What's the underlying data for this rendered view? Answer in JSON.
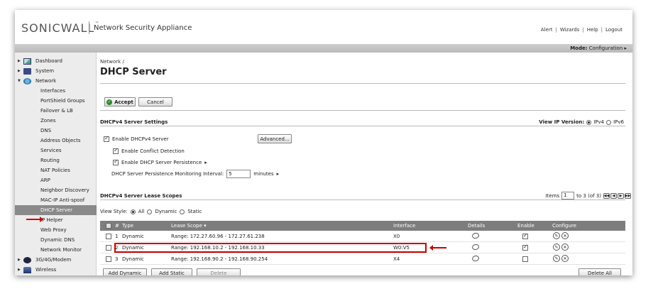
{
  "header": {
    "logo": "SONICWALL",
    "app_title": "Network Security Appliance",
    "links": [
      "Alert",
      "Wizards",
      "Help",
      "Logout"
    ]
  },
  "modebar": {
    "mode_label": "Mode:",
    "mode_value": "Configuration ▸"
  },
  "sidebar": {
    "items": [
      {
        "label": "Dashboard",
        "kind": "top",
        "icon": "dashboard-icon"
      },
      {
        "label": "System",
        "kind": "top",
        "icon": "system-icon"
      },
      {
        "label": "Network",
        "kind": "top",
        "icon": "network-icon",
        "expanded": true
      },
      {
        "label": "Interfaces",
        "kind": "sub"
      },
      {
        "label": "PortShield Groups",
        "kind": "sub"
      },
      {
        "label": "Failover & LB",
        "kind": "sub"
      },
      {
        "label": "Zones",
        "kind": "sub"
      },
      {
        "label": "DNS",
        "kind": "sub"
      },
      {
        "label": "Address Objects",
        "kind": "sub"
      },
      {
        "label": "Services",
        "kind": "sub"
      },
      {
        "label": "Routing",
        "kind": "sub"
      },
      {
        "label": "NAT Policies",
        "kind": "sub"
      },
      {
        "label": "ARP",
        "kind": "sub"
      },
      {
        "label": "Neighbor Discovery",
        "kind": "sub"
      },
      {
        "label": "MAC-IP Anti-spoof",
        "kind": "sub"
      },
      {
        "label": "DHCP Server",
        "kind": "sub",
        "active": true
      },
      {
        "label": "IP Helper",
        "kind": "sub"
      },
      {
        "label": "Web Proxy",
        "kind": "sub"
      },
      {
        "label": "Dynamic DNS",
        "kind": "sub"
      },
      {
        "label": "Network Monitor",
        "kind": "sub"
      },
      {
        "label": "3G/4G/Modem",
        "kind": "top",
        "icon": "modem-icon"
      },
      {
        "label": "Wireless",
        "kind": "top",
        "icon": "wireless-icon"
      }
    ]
  },
  "main": {
    "breadcrumb": "Network /",
    "title": "DHCP Server",
    "accept_label": "Accept",
    "cancel_label": "Cancel",
    "settings": {
      "title": "DHCPv4 Server Settings",
      "ip_version_label": "View IP Version:",
      "ipv4_label": "IPv4",
      "ipv6_label": "IPv6",
      "enable_server_label": "Enable DHCPv4 Server",
      "advanced_label": "Advanced...",
      "conflict_label": "Enable Conflict Detection",
      "persistence_label": "Enable DHCP Server Persistence",
      "interval_label": "DHCP Server Persistence Monitoring Interval:",
      "interval_value": "5",
      "interval_unit": "minutes"
    },
    "scopes": {
      "title": "DHCPv4 Server Lease Scopes",
      "items_label": "Items",
      "items_value": "1",
      "items_suffix": "to 3 (of 3)",
      "view_style_label": "View Style:",
      "view_all": "All",
      "view_dynamic": "Dynamic",
      "view_static": "Static",
      "columns": {
        "num": "#",
        "type": "Type",
        "scope": "Lease Scope ▾",
        "iface": "Interface",
        "details": "Details",
        "enable": "Enable",
        "configure": "Configure"
      },
      "rows": [
        {
          "num": "1",
          "type": "Dynamic",
          "scope": "Range: 172.27.60.96 - 172.27.61.238",
          "iface": "X0",
          "enabled": true
        },
        {
          "num": "2",
          "type": "Dynamic",
          "scope": "Range: 192.168.10.2 - 192.168.10.33",
          "iface": "W0:V5",
          "enabled": true,
          "highlighted": true
        },
        {
          "num": "3",
          "type": "Dynamic",
          "scope": "Range: 192.168.90.2 - 192.168.90.254",
          "iface": "X4",
          "enabled": false
        }
      ],
      "add_dynamic_label": "Add Dynamic",
      "add_static_label": "Add Static",
      "delete_label": "Delete",
      "delete_all_label": "Delete All"
    }
  }
}
